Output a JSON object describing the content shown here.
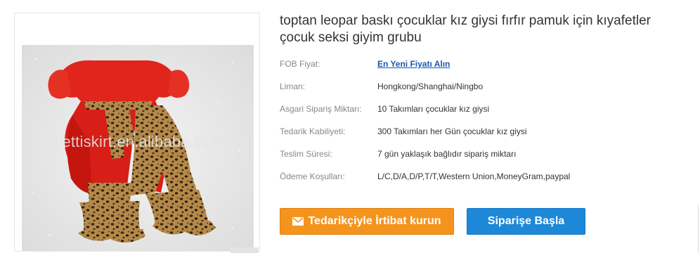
{
  "product": {
    "title": "toptan leopar baskı çocuklar kız giysi fırfır pamuk için kıyafetler çocuk seksi giyim grubu",
    "image_watermark": "pettiskirt.en.alibaba.com"
  },
  "details": [
    {
      "label": "FOB Fiyat:",
      "value": "En Yeni Fiyatı Alın",
      "is_link": true
    },
    {
      "label": "Liman:",
      "value": "Hongkong/Shanghai/Ningbo"
    },
    {
      "label": "Asgari Sipariş Miktarı:",
      "value": "10 Takımları çocuklar kız giysi"
    },
    {
      "label": "Tedarik Kabiliyeti:",
      "value": "300 Takımları her Gün çocuklar kız giysi"
    },
    {
      "label": "Teslim Süresi:",
      "value": "7 gün yaklaşık bağlıdır sipariş miktarı"
    },
    {
      "label": "Ödeme Koşulları:",
      "value": "L/C,D/A,D/P,T/T,Western Union,MoneyGram,paypal"
    }
  ],
  "buttons": {
    "contact_label": "Tedarikçiyle İrtibat kurun",
    "order_label": "Siparişe Başla"
  },
  "colors": {
    "contact_button": "#f5941d",
    "order_button": "#1e88d8",
    "link": "#1a57b3"
  },
  "icons": {
    "contact_icon": "envelope-icon"
  }
}
